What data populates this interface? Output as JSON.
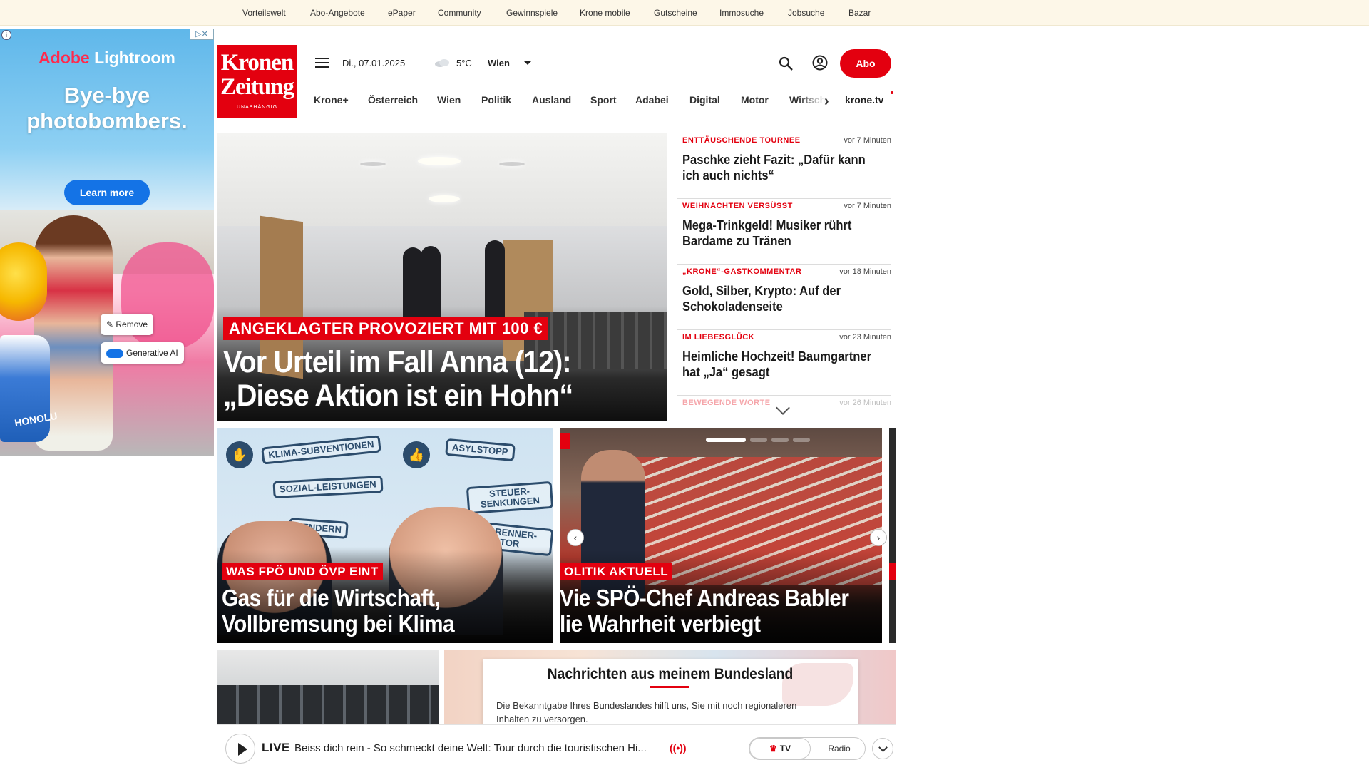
{
  "topnav": [
    "Vorteilswelt",
    "Abo-Angebote",
    "ePaper",
    "Community",
    "Gewinnspiele",
    "Krone mobile",
    "Gutscheine",
    "Immosuche",
    "Jobsuche",
    "Bazar"
  ],
  "ad": {
    "brand_adobe": "Adobe",
    "brand_product": " Lightroom",
    "headline_1": "Bye-bye",
    "headline_2": "photobombers.",
    "cta": "Learn more",
    "remove_chip": "Remove",
    "genai_chip": "Generative AI",
    "cup_text": "HONOLU"
  },
  "logo": {
    "line1": "Kronen",
    "line2": "Zeitung",
    "tagline": "UNABHÄNGIG"
  },
  "header": {
    "date": "Di., 07.01.2025",
    "temperature": "5°C",
    "city": "Wien",
    "abo_label": "Abo"
  },
  "nav": {
    "items": [
      "Krone+",
      "Österreich",
      "Wien",
      "Politik",
      "Ausland",
      "Sport",
      "Adabei",
      "Digital",
      "Motor",
      "Wirtsch"
    ],
    "tv": "krone.tv"
  },
  "hero": {
    "kicker": "ANGEKLAGTER PROVOZIERT MIT 100 €",
    "title_1": "Vor Urteil im Fall Anna (12):",
    "title_2": "„Diese Aktion ist ein Hohn“"
  },
  "ticker": [
    {
      "kicker": "ENTTÄUSCHENDE TOURNEE",
      "time": "vor 7 Minuten",
      "title": "Paschke zieht Fazit: „Dafür kann ich auch nichts“"
    },
    {
      "kicker": "WEIHNACHTEN VERSÜSST",
      "time": "vor 7 Minuten",
      "title": "Mega-Trinkgeld! Musiker rührt Bardame zu Tränen"
    },
    {
      "kicker": "„KRONE“-GASTKOMMENTAR",
      "time": "vor 18 Minuten",
      "title": "Gold, Silber, Krypto: Auf der Schokoladenseite"
    },
    {
      "kicker": "IM LIEBESGLÜCK",
      "time": "vor 23 Minuten",
      "title": "Heimliche Hochzeit! Baumgartner hat „Ja“ gesagt"
    },
    {
      "kicker": "BEWEGENDE WORTE",
      "time": "vor 26 Minuten"
    }
  ],
  "cards": {
    "c1": {
      "kicker": "WAS FPÖ UND ÖVP EINT",
      "title_1": "Gas für die Wirtschaft,",
      "title_2": "Vollbremsung bei Klima",
      "stamps": [
        "KLIMA-SUBVENTIONEN",
        "SOZIAL-LEISTUNGEN",
        "GENDERN",
        "ASYLSTOPP",
        "STEUER-SENKUNGEN",
        "VERBRENNER-MOTOR"
      ]
    },
    "c2": {
      "kicker": "OLITIK AKTUELL",
      "title_1": "Vie SPÖ-Chef Andreas Babler",
      "title_2": "lie Wahrheit verbiegt"
    }
  },
  "region": {
    "title": "Nachrichten aus meinem Bundesland",
    "text": "Die Bekanntgabe Ihres Bundeslandes hilft uns, Sie mit noch regionaleren Inhalten zu versorgen."
  },
  "player": {
    "live": "LIVE",
    "text": "Beiss dich rein - So schmeckt deine Welt: Tour durch die touristischen Hi...",
    "tv": "TV",
    "radio": "Radio"
  },
  "colors": {
    "brand_red": "#e3000f",
    "topbar_bg": "#fdf7e8",
    "ad_cta_blue": "#1473e6"
  }
}
